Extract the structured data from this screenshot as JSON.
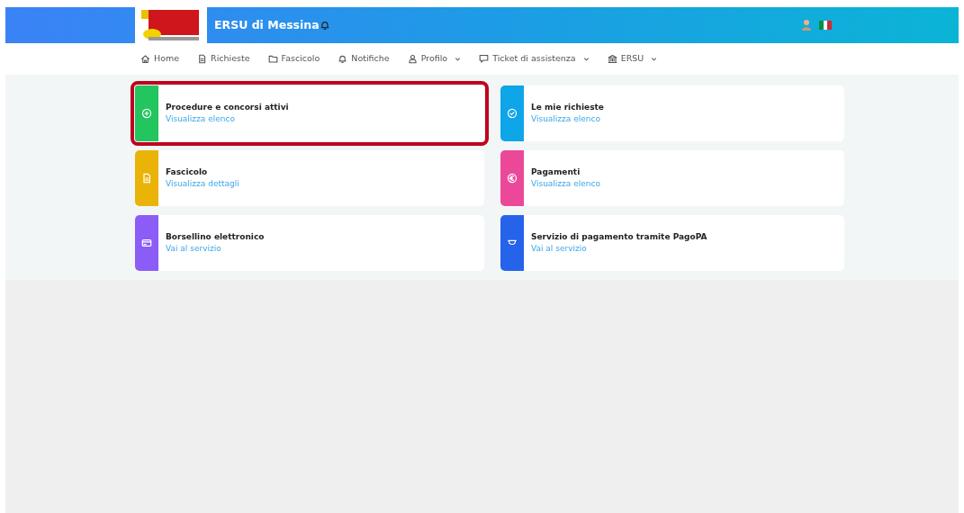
{
  "header": {
    "title": "ERSU di Messina"
  },
  "nav": [
    {
      "label": "Home",
      "kind": "home",
      "dropdown": false
    },
    {
      "label": "Richieste",
      "kind": "doc",
      "dropdown": false
    },
    {
      "label": "Fascicolo",
      "kind": "folder",
      "dropdown": false
    },
    {
      "label": "Notifiche",
      "kind": "bell",
      "dropdown": false
    },
    {
      "label": "Profilo",
      "kind": "user",
      "dropdown": true
    },
    {
      "label": "Ticket di assistenza",
      "kind": "chat",
      "dropdown": true
    },
    {
      "label": "ERSU",
      "kind": "bank",
      "dropdown": true
    }
  ],
  "cards": [
    {
      "title": "Procedure e concorsi attivi",
      "link": "Visualizza elenco",
      "kind": "plus",
      "color": "#22c55e",
      "highlighted": true
    },
    {
      "title": "Le mie richieste",
      "link": "Visualizza elenco",
      "kind": "check",
      "color": "#0ea5e9",
      "highlighted": false
    },
    {
      "title": "Fascicolo",
      "link": "Visualizza dettagli",
      "kind": "doc",
      "color": "#eab308",
      "highlighted": false
    },
    {
      "title": "Pagamenti",
      "link": "Visualizza elenco",
      "kind": "euro",
      "color": "#ec4899",
      "highlighted": false
    },
    {
      "title": "Borsellino elettronico",
      "link": "Vai al servizio",
      "kind": "card",
      "color": "#8b5cf6",
      "highlighted": false
    },
    {
      "title": "Servizio di pagamento tramite PagoPA",
      "link": "Vai al servizio",
      "kind": "pagopa",
      "color": "#2563eb",
      "highlighted": false
    }
  ]
}
